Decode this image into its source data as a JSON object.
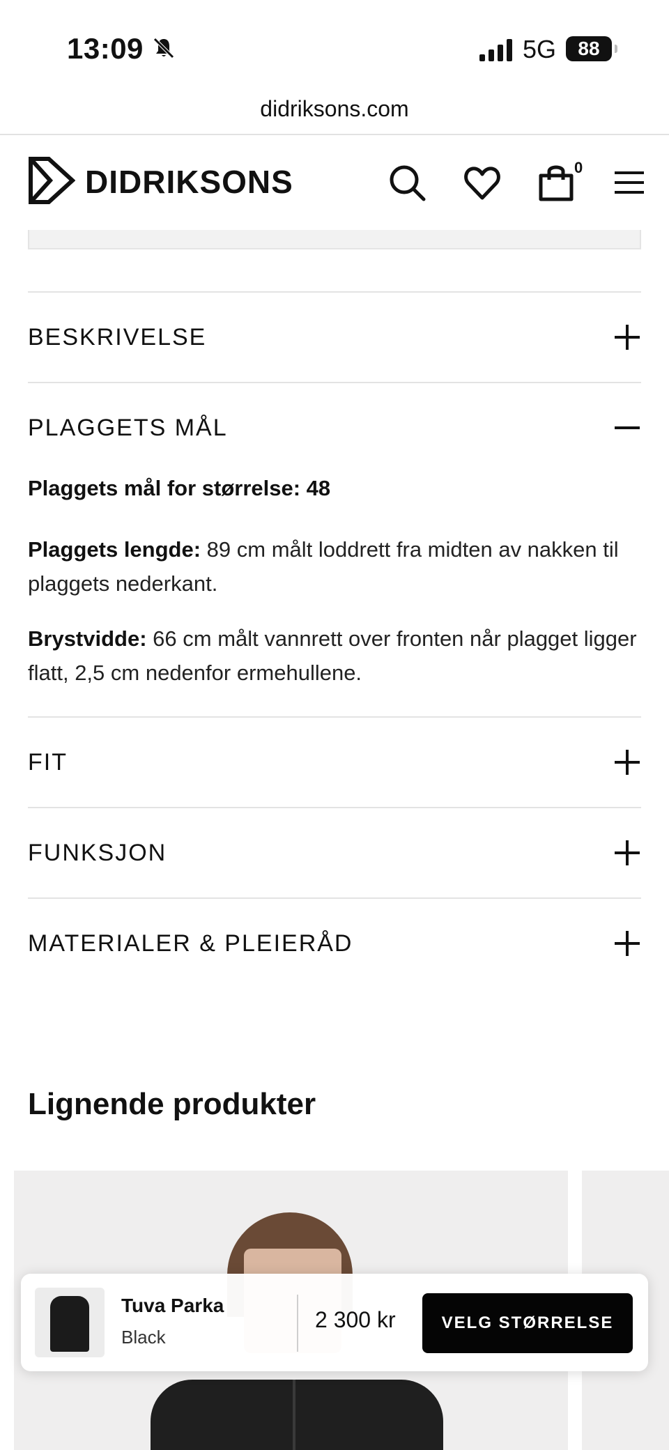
{
  "status_bar": {
    "time": "13:09",
    "network": "5G",
    "battery": "88"
  },
  "browser": {
    "url": "didriksons.com"
  },
  "header": {
    "brand": "DIDRIKSONS",
    "cart_count": "0"
  },
  "accordion": [
    {
      "title": "BESKRIVELSE",
      "expanded": false
    },
    {
      "title": "PLAGGETS MÅL",
      "expanded": true
    },
    {
      "title": "FIT",
      "expanded": false
    },
    {
      "title": "FUNKSJON",
      "expanded": false
    },
    {
      "title": "MATERIALER & PLEIERÅD",
      "expanded": false
    }
  ],
  "measurements": {
    "size_label": "Plaggets mål for størrelse: 48",
    "length_label": "Plaggets lengde:",
    "length_text": " 89 cm målt loddrett fra midten av nakken til plaggets nederkant.",
    "chest_label": "Brystvidde:",
    "chest_text": " 66 cm målt vannrett over fronten når plagget ligger flatt, 2,5 cm nedenfor ermehullene."
  },
  "similar": {
    "title": "Lignende produkter"
  },
  "buy_bar": {
    "product_name": "Tuva Parka",
    "color": "Black",
    "price": "2 300 kr",
    "cta_label": "VELG STØRRELSE"
  }
}
